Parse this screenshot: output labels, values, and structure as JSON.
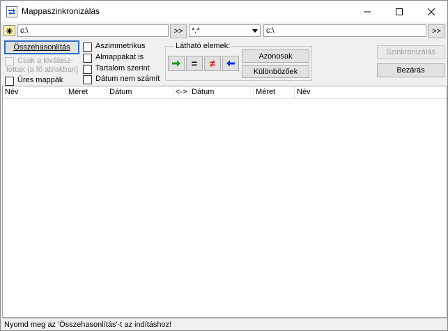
{
  "window": {
    "title": "Mappaszinkronizálás"
  },
  "left_path": {
    "value": "c:\\"
  },
  "left_browse_label": ">>",
  "filter": {
    "value": "*.*"
  },
  "right_path": {
    "value": "c:\\"
  },
  "right_browse_label": ">>",
  "compare_button": "Összehasonlítás",
  "options": {
    "only_selected": "Csak a kiválasz-\ntottak (a fő ablakban)",
    "empty_folders": "Üres mappák",
    "asymmetric": "Aszimmetrikus",
    "subfolders": "Almappákat is",
    "by_content": "Tartalom szerint",
    "ignore_date": "Dátum nem számít"
  },
  "visible_group": {
    "label": "Látható elemek:",
    "identical_button": "Azonosak",
    "different_button": "Különbözőek",
    "eq_symbol": "=",
    "neq_symbol": "≠"
  },
  "sync_button": "Szinkronizálás",
  "close_button": "Bezárás",
  "columns": [
    "Név",
    "Méret",
    "Dátum",
    "<->",
    "Dátum",
    "Méret",
    "Név"
  ],
  "status_text": "Nyomd meg az 'Összehasonlítás'-t az indításhoz!",
  "colors": {
    "green": "#1a9a1a",
    "red": "#e01010",
    "blue": "#1030e0"
  }
}
